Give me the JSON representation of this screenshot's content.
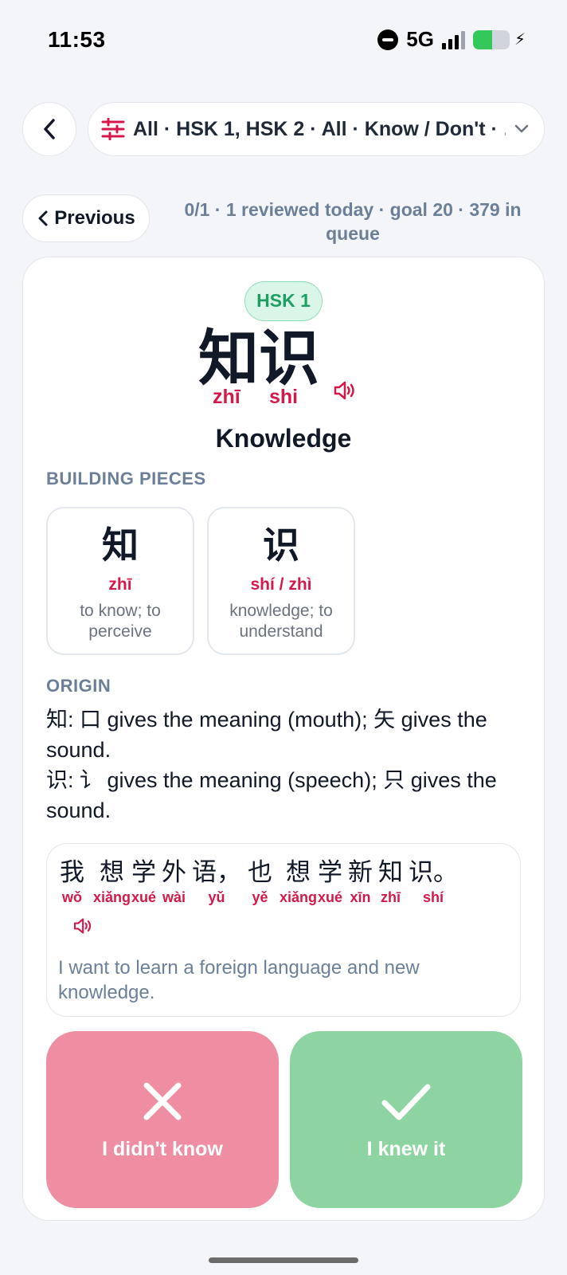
{
  "status_bar": {
    "time": "11:53",
    "network": "5G"
  },
  "nav": {
    "filter_summary": "All · HSK 1, HSK 2 · All · Know / Don't · …",
    "previous_label": "Previous",
    "progress_line1": "0/1 · 1 reviewed today · goal 20 · 379 in",
    "progress_line2": "queue"
  },
  "card": {
    "level_badge": "HSK 1",
    "hanzi": "知识",
    "pinyin": [
      "zhī",
      "shi"
    ],
    "meaning": "Knowledge",
    "building_pieces_label": "BUILDING PIECES",
    "pieces": [
      {
        "char": "知",
        "pinyin": "zhī",
        "meaning": "to know; to perceive"
      },
      {
        "char": "识",
        "pinyin": "shí / zhì",
        "meaning": "knowledge; to understand"
      }
    ],
    "origin_label": "ORIGIN",
    "origin": [
      "知: 口 gives the meaning (mouth); 矢 gives the sound.",
      "识: 讠 gives the meaning (speech); 只 gives the sound."
    ],
    "example": {
      "tokens": [
        {
          "char": "我",
          "pinyin": "wǒ"
        },
        {
          "char": "想",
          "pinyin": "xiǎng"
        },
        {
          "char": "学",
          "pinyin": "xué"
        },
        {
          "char": "外",
          "pinyin": "wài"
        },
        {
          "char": "语，",
          "pinyin": "yǔ"
        },
        {
          "char": "也",
          "pinyin": "yě"
        },
        {
          "char": "想",
          "pinyin": "xiǎng"
        },
        {
          "char": "学",
          "pinyin": "xué"
        },
        {
          "char": "新",
          "pinyin": "xīn"
        },
        {
          "char": "知",
          "pinyin": "zhī"
        },
        {
          "char": "识。",
          "pinyin": "shí"
        }
      ],
      "translation": "I want to learn a foreign language and new knowledge."
    },
    "buttons": {
      "dont_know": "I didn't know",
      "knew": "I knew it"
    }
  },
  "colors": {
    "accent_red": "#d4194a",
    "badge_green": "#1e9e63",
    "dont_know_bg": "#ef8ea2",
    "knew_bg": "#8ed3a2"
  },
  "icons": [
    "back-chevron-icon",
    "filter-sliders-icon",
    "chevron-down-icon",
    "chevron-left-icon",
    "speaker-icon",
    "close-x-icon",
    "checkmark-icon"
  ]
}
